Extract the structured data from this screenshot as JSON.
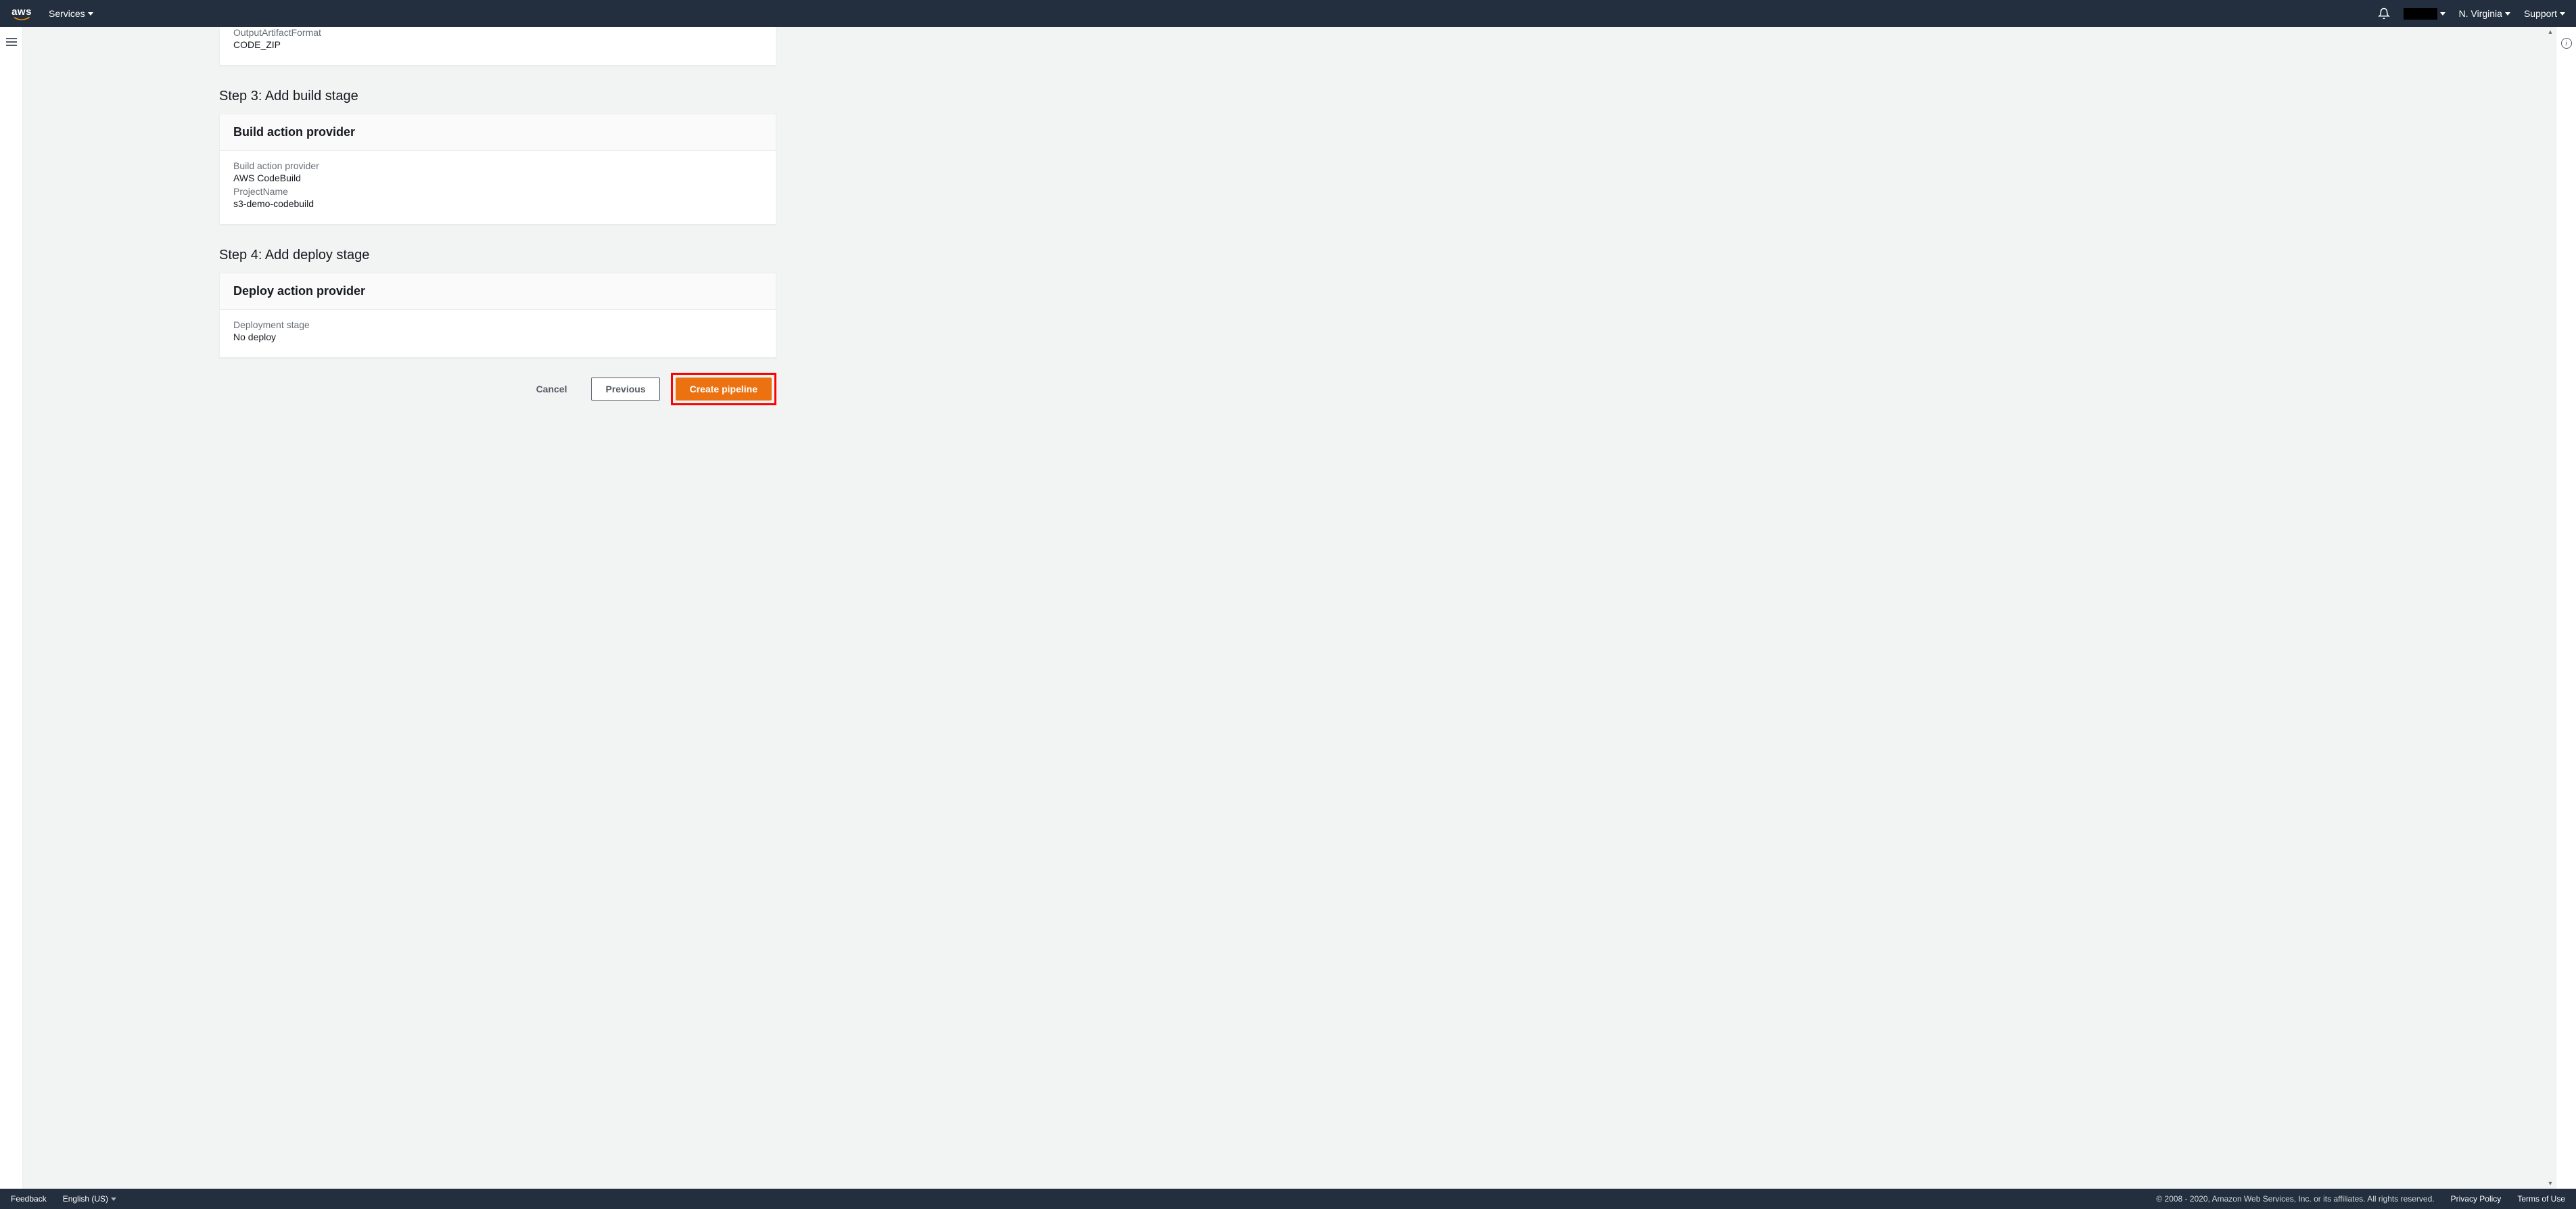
{
  "header": {
    "logo_text": "aws",
    "services": "Services",
    "region": "N. Virginia",
    "support": "Support"
  },
  "source_card": {
    "field1_label": "OutputArtifactFormat",
    "field1_value": "CODE_ZIP"
  },
  "step3": {
    "heading": "Step 3: Add build stage",
    "card_title": "Build action provider",
    "provider_label": "Build action provider",
    "provider_value": "AWS CodeBuild",
    "project_label": "ProjectName",
    "project_value": "s3-demo-codebuild"
  },
  "step4": {
    "heading": "Step 4: Add deploy stage",
    "card_title": "Deploy action provider",
    "stage_label": "Deployment stage",
    "stage_value": "No deploy"
  },
  "actions": {
    "cancel": "Cancel",
    "previous": "Previous",
    "create": "Create pipeline"
  },
  "footer": {
    "feedback": "Feedback",
    "language": "English (US)",
    "copyright": "© 2008 - 2020, Amazon Web Services, Inc. or its affiliates. All rights reserved.",
    "privacy": "Privacy Policy",
    "terms": "Terms of Use"
  }
}
